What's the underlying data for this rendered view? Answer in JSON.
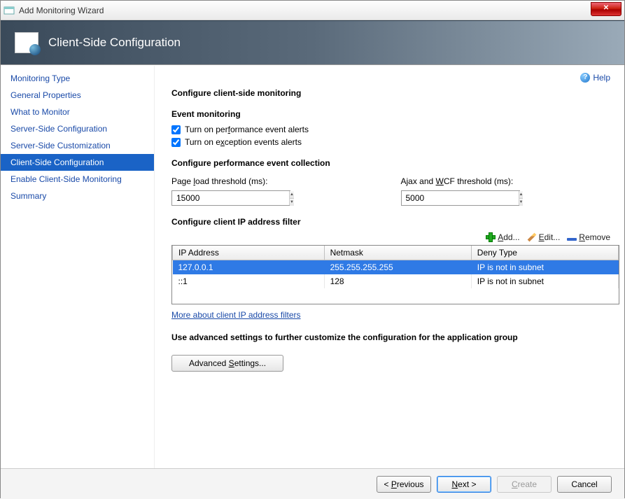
{
  "window": {
    "title": "Add Monitoring Wizard"
  },
  "banner": {
    "title": "Client-Side Configuration"
  },
  "help": {
    "label": "Help"
  },
  "sidebar": {
    "items": [
      {
        "label": "Monitoring Type"
      },
      {
        "label": "General Properties"
      },
      {
        "label": "What to Monitor"
      },
      {
        "label": "Server-Side Configuration"
      },
      {
        "label": "Server-Side Customization"
      },
      {
        "label": "Client-Side Configuration"
      },
      {
        "label": "Enable Client-Side Monitoring"
      },
      {
        "label": "Summary"
      }
    ],
    "activeIndex": 5
  },
  "main": {
    "heading": "Configure client-side monitoring",
    "eventMonitoring": {
      "title": "Event monitoring",
      "perfAlerts": {
        "pre": "Turn on per",
        "u": "f",
        "post": "ormance event alerts",
        "checked": true
      },
      "excAlerts": {
        "pre": "Turn on e",
        "u": "x",
        "post": "ception events alerts",
        "checked": true
      }
    },
    "perfCollection": {
      "title": "Configure performance event collection",
      "pageLoad": {
        "pre": "Page ",
        "u": "l",
        "post": "oad threshold (ms):",
        "value": "15000"
      },
      "ajaxWcf": {
        "pre": "Ajax and ",
        "u": "W",
        "post": "CF threshold (ms):",
        "value": "5000"
      }
    },
    "ipFilter": {
      "title": "Configure client IP address filter",
      "toolbar": {
        "add": "Add...",
        "edit": "Edit...",
        "remove": "Remove"
      },
      "columns": {
        "ip": "IP Address",
        "mask": "Netmask",
        "deny": "Deny Type"
      },
      "rows": [
        {
          "ip": "127.0.0.1",
          "mask": "255.255.255.255",
          "deny": "IP is not in subnet",
          "selected": true
        },
        {
          "ip": "::1",
          "mask": "128",
          "deny": "IP is not in subnet",
          "selected": false
        }
      ],
      "moreLink": "More about client IP address filters"
    },
    "advanced": {
      "text": "Use advanced settings to further customize the configuration for the application group",
      "btn_pre": "Advanced ",
      "btn_u": "S",
      "btn_post": "ettings..."
    }
  },
  "footer": {
    "previous": {
      "lt": "< ",
      "u": "P",
      "post": "revious"
    },
    "next": {
      "u": "N",
      "post": "ext >",
      "enabled": true,
      "default": true
    },
    "create": {
      "u": "C",
      "post": "reate",
      "enabled": false
    },
    "cancel": {
      "label": "Cancel"
    }
  }
}
